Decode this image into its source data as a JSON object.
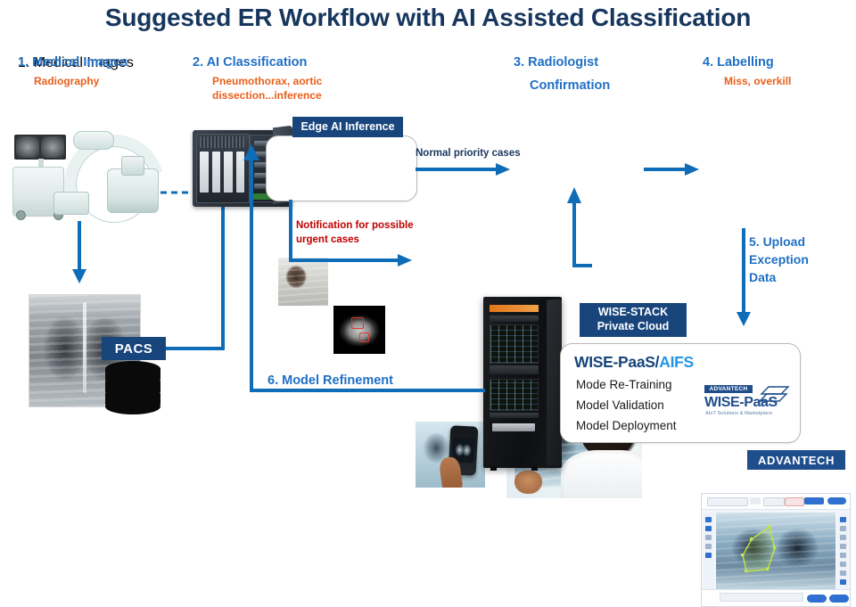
{
  "title": "Suggested ER Workflow with AI Assisted Classification",
  "steps": [
    {
      "heading": "1. Medical Images",
      "sub": "Radiography",
      "sub_color": "orange"
    },
    {
      "heading": "2. AI Classification",
      "sub": "Pneumothorax, aortic\ndissection...inference",
      "sub_color": "orange"
    },
    {
      "heading": "3. Radiologist",
      "sub": "Confirmation",
      "sub_color": "blue"
    },
    {
      "heading": "4. Labelling",
      "sub": "Miss, overkill",
      "sub_color": "orange"
    }
  ],
  "step3_heading_line1": "3. Radiologist",
  "step3_heading_line2": "Confirmation",
  "step2_sub_line1": "Pneumothorax, aortic",
  "step2_sub_line2": "dissection...inference",
  "badges": {
    "edge_ai": "Edge AI Inference",
    "pacs": "PACS",
    "wise_stack_line1": "WISE-STACK",
    "wise_stack_line2": "Private Cloud"
  },
  "arrow_labels": {
    "normal_priority": "Normal priority cases",
    "notification_line1": "Notification for possible",
    "notification_line2": "urgent cases",
    "model_refinement": "6. Model Refinement",
    "upload_line1": "5. Upload",
    "upload_line2": "Exception",
    "upload_line3": "Data"
  },
  "cloud_panel": {
    "title_main": "WISE-PaaS/",
    "title_accent": "AIFS",
    "items": [
      "Mode Re-Training",
      "Model Validation",
      "Model Deployment"
    ]
  },
  "logos": {
    "wise_paas_advantech": "ADVANTECH",
    "wise_paas_name": "WISE-PaaS",
    "wise_paas_tagline": "AIoT Solutions & Marketplace",
    "advantech": "ADVANTECH"
  },
  "colors": {
    "title": "#17365D",
    "heading_blue": "#1F6FC4",
    "sub_orange": "#E8601C",
    "badge_navy": "#17457C",
    "arrow_blue": "#0F6CB6",
    "alert_red": "#C00000",
    "accent_cyan": "#2196E3"
  }
}
